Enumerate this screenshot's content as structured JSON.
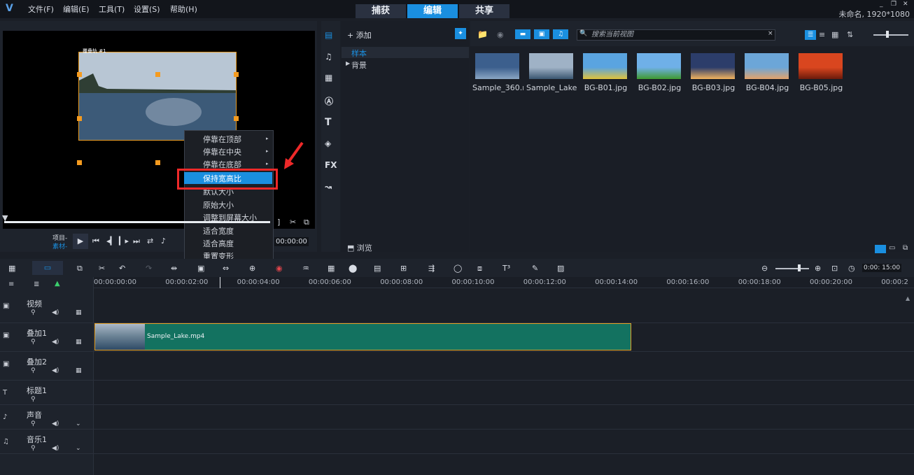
{
  "titlebar": {
    "menus": [
      "文件(F)",
      "编辑(E)",
      "工具(T)",
      "设置(S)",
      "帮助(H)"
    ],
    "tabs": [
      "捕获",
      "编辑",
      "共享"
    ],
    "active_tab": "编辑",
    "project_info": "未命名, 1920*1080"
  },
  "preview": {
    "overlay_label": "覆叠轨 #1",
    "mode_labels": [
      "项目-",
      "素材-"
    ],
    "timecode": "00:00:00"
  },
  "context_menu": {
    "items": [
      "停靠在顶部",
      "停靠在中央",
      "停靠在底部",
      "保持宽高比",
      "默认大小",
      "原始大小",
      "调整到屏幕大小",
      "适合宽度",
      "适合高度",
      "重置变形"
    ],
    "submenu_flags": [
      true,
      true,
      true,
      false,
      false,
      false,
      false,
      false,
      false,
      false
    ],
    "highlighted": "保持宽高比"
  },
  "library": {
    "add_label": "添加",
    "tree": [
      "样本",
      "背景"
    ],
    "browse_label": "浏览",
    "search_placeholder": "搜索当前视图",
    "thumbnails": [
      {
        "label": "Sample_360.m...",
        "colors": [
          "#3c5f8d",
          "#8aa6c4"
        ]
      },
      {
        "label": "Sample_Lake...",
        "colors": [
          "#9fb2c6",
          "#3a5670"
        ]
      },
      {
        "label": "BG-B01.jpg",
        "colors": [
          "#5aa4e0",
          "#e0c23a"
        ]
      },
      {
        "label": "BG-B02.jpg",
        "colors": [
          "#6fb0e8",
          "#3f9a2f"
        ]
      },
      {
        "label": "BG-B03.jpg",
        "colors": [
          "#2c3d6a",
          "#f3b35e"
        ]
      },
      {
        "label": "BG-B04.jpg",
        "colors": [
          "#6ca6d8",
          "#e4a36a"
        ]
      },
      {
        "label": "BG-B05.jpg",
        "colors": [
          "#d9461f",
          "#6b1a0b"
        ]
      }
    ]
  },
  "timeline": {
    "ruler_ticks": [
      "00:00:00:00",
      "00:00:02:00",
      "00:00:04:00",
      "00:00:06:00",
      "00:00:08:00",
      "00:00:10:00",
      "00:00:12:00",
      "00:00:14:00",
      "00:00:16:00",
      "00:00:18:00",
      "00:00:20:00",
      "00:00:2"
    ],
    "zoom_timecode": "0:00: 15:00",
    "tracks": [
      "视频",
      "叠加1",
      "叠加2",
      "标题1",
      "声音",
      "音乐1"
    ],
    "clip_label": "Sample_Lake.mp4"
  },
  "colors": {
    "accent": "#1a8fe0",
    "clip": "#137260",
    "highlight_border": "#ee2929",
    "handle": "#f59b1f"
  }
}
